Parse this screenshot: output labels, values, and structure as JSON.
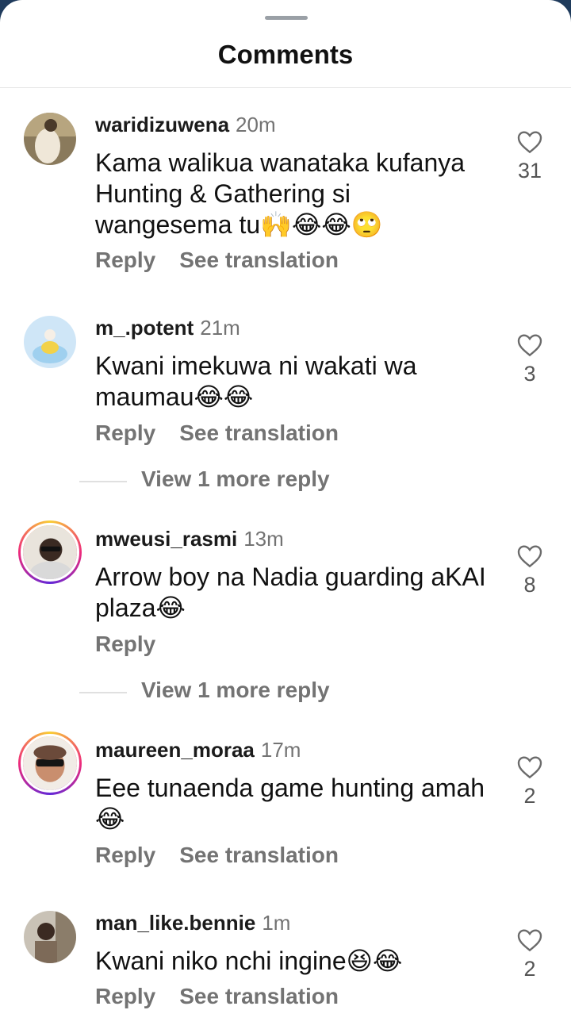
{
  "sheet": {
    "title": "Comments"
  },
  "comments": [
    {
      "username": "waridizuwena",
      "time": "20m",
      "text": "Kama walikua wanataka kufanya Hunting & Gathering si wangesema tu🙌😂😂🙄",
      "likes": "31",
      "reply_label": "Reply",
      "translate_label": "See translation"
    },
    {
      "username": "m_.potent",
      "time": "21m",
      "text": "Kwani imekuwa ni wakati wa maumau😂😂",
      "likes": "3",
      "reply_label": "Reply",
      "translate_label": "See translation",
      "view_more": "View 1 more reply"
    },
    {
      "username": "mweusi_rasmi",
      "time": "13m",
      "text": "Arrow boy na Nadia guarding aKAI plaza😂",
      "likes": "8",
      "reply_label": "Reply",
      "view_more": "View 1 more reply"
    },
    {
      "username": "maureen_moraa",
      "time": "17m",
      "text": "Eee tunaenda game hunting amah 😂",
      "likes": "2",
      "reply_label": "Reply",
      "translate_label": "See translation"
    },
    {
      "username": "man_like.bennie",
      "time": "1m",
      "text": "Kwani niko nchi ingine😆😂",
      "likes": "2",
      "reply_label": "Reply",
      "translate_label": "See translation"
    }
  ]
}
